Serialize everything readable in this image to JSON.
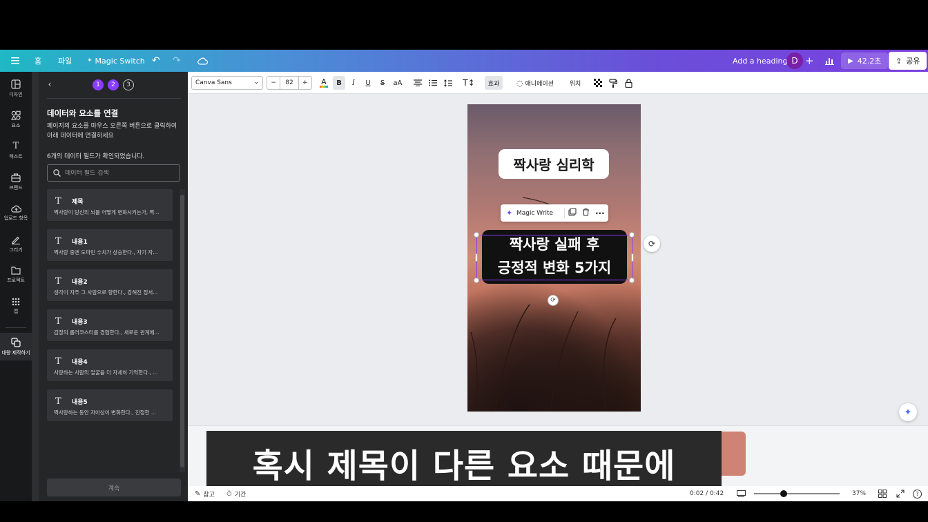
{
  "topbar": {
    "home": "홈",
    "file": "파일",
    "magic_switch": "Magic Switch",
    "heading": "Add a heading",
    "avatar_initial": "D",
    "play_time": "42.2초",
    "share": "공유"
  },
  "rail": [
    {
      "label": "디자인",
      "icon": "design-icon"
    },
    {
      "label": "요소",
      "icon": "elements-icon"
    },
    {
      "label": "텍스트",
      "icon": "text-icon"
    },
    {
      "label": "브랜드",
      "icon": "brand-icon"
    },
    {
      "label": "업로드 항목",
      "icon": "upload-icon"
    },
    {
      "label": "그리기",
      "icon": "draw-icon"
    },
    {
      "label": "프로젝트",
      "icon": "projects-icon"
    },
    {
      "label": "앱",
      "icon": "apps-icon"
    },
    {
      "label": "대량 제작하기",
      "icon": "bulk-create-icon"
    }
  ],
  "panel": {
    "steps": [
      "1",
      "2",
      "3"
    ],
    "title": "데이터와 요소를 연결",
    "description": "페이지의 요소를 마우스 오른쪽 버튼으로 클릭하여 아래 데이터에 연결하세요",
    "count_text": "6개의 데이터 필드가 확인되었습니다.",
    "search_placeholder": "데이터 필드 검색",
    "fields": [
      {
        "name": "제목",
        "value": "짝사랑이 당신의 뇌를 어떻게 변화시키는가, 짝..."
      },
      {
        "name": "내용1",
        "value": "짝사랑 중엔 도파민 수치가 상승한다., 자기 자..."
      },
      {
        "name": "내용2",
        "value": "생각이 자주 그 사람으로 향한다., 강해진 정서..."
      },
      {
        "name": "내용3",
        "value": "감정의 롤러코스터를 경험한다., 새로운 관계에..."
      },
      {
        "name": "내용4",
        "value": "사랑하는 사람의 얼굴을 더 자세히 기억한다., ..."
      },
      {
        "name": "내용5",
        "value": "짝사랑하는 동안 자아상이 변화한다., 진정한 ..."
      }
    ],
    "continue": "계속"
  },
  "toolbar": {
    "font": "Canva Sans",
    "size": "82",
    "minus": "−",
    "plus": "+",
    "effects": "효과",
    "animation": "애니메이션",
    "position": "위치"
  },
  "canvas": {
    "title_text": "짝사랑 심리학",
    "magic_write": "Magic Write",
    "selected_text_line1": "짝사랑 실패 후",
    "selected_text_line2": "긍정적 변화 5가지"
  },
  "subtitle": "혹시 제목이 다른 요소 때문에",
  "bottombar": {
    "notes": "참고",
    "duration": "기간",
    "time": "0:02 / 0:42",
    "zoom": "37%"
  },
  "colors": {
    "accent": "#8b3dff",
    "topbar_start": "#1fb8c4",
    "topbar_end": "#7b3fe0"
  }
}
